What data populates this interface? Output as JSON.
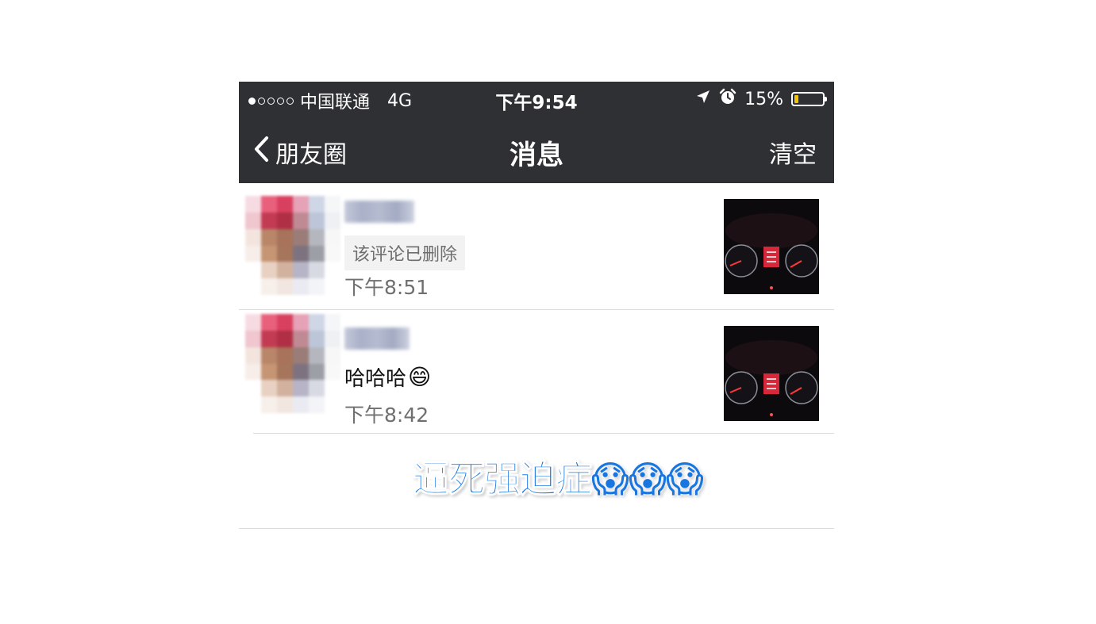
{
  "status_bar": {
    "signal_dots": [
      true,
      false,
      false,
      false,
      false
    ],
    "carrier": "中国联通",
    "network": "4G",
    "time": "下午9:54",
    "location_icon": "location-arrow-icon",
    "alarm_icon": "alarm-clock-icon",
    "battery_percent": "15%",
    "battery_level": 0.15,
    "battery_color": "#f5c20a"
  },
  "nav": {
    "back_label": "朋友圈",
    "title": "消息",
    "right_label": "清空"
  },
  "messages": [
    {
      "comment": "该评论已删除",
      "comment_deleted": true,
      "time": "下午8:51"
    },
    {
      "comment": "哈哈哈",
      "emoji": "😄",
      "comment_deleted": false,
      "time": "下午8:42"
    }
  ],
  "overlay_caption": {
    "text": "逼死强迫症",
    "emojis": "😱😱😱",
    "color": "#1976e0"
  },
  "colors": {
    "header_bg": "#2f3033",
    "divider": "#dcdcdc",
    "time_text": "#6f6f6f"
  }
}
